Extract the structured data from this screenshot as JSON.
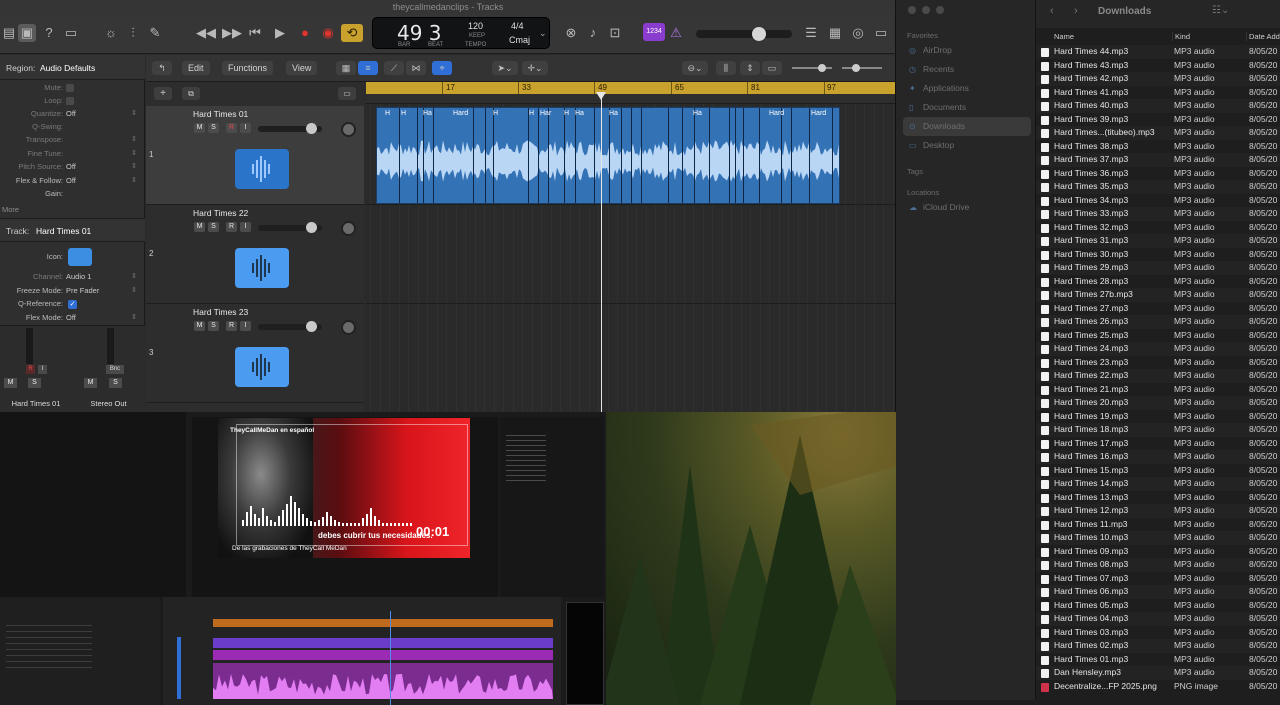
{
  "logic": {
    "window_title": "theycallmedanclips - Tracks",
    "lcd": {
      "bar_beat": "49 3",
      "bar_label": "BAR",
      "beat_label": "BEAT",
      "tempo": "120",
      "keep": "KEEP",
      "tempo_label": "TEMPO",
      "signature": "4/4",
      "key": "Cmaj"
    },
    "badge": "1234",
    "menu": {
      "edit": "Edit",
      "functions": "Functions",
      "view": "View"
    },
    "inspector": {
      "region_label": "Region:",
      "region_value": "Audio Defaults",
      "rows": [
        {
          "label": "Mute:",
          "value": ""
        },
        {
          "label": "Loop:",
          "value": ""
        },
        {
          "label": "Quantize:",
          "value": "Off"
        },
        {
          "label": "Q-Swing:",
          "value": ""
        },
        {
          "label": "Transpose:",
          "value": ""
        },
        {
          "label": "Fine Tune:",
          "value": ""
        },
        {
          "label": "Pitch Source:",
          "value": "Off"
        },
        {
          "label": "Flex & Follow:",
          "value": "Off"
        },
        {
          "label": "Gain:",
          "value": ""
        }
      ],
      "more": "More",
      "track_label": "Track:",
      "track_value": "Hard Times 01",
      "track_rows": [
        {
          "label": "Icon:",
          "value": ""
        },
        {
          "label": "Channel:",
          "value": "Audio 1"
        },
        {
          "label": "Freeze Mode:",
          "value": "Pre Fader"
        },
        {
          "label": "Q-Reference:",
          "value": ""
        },
        {
          "label": "Flex Mode:",
          "value": "Off"
        }
      ]
    },
    "mixer": {
      "strip1": "Hard Times 01",
      "strip2": "Stereo Out",
      "m": "M",
      "s": "S",
      "bnc": "Bnc",
      "i": "I"
    },
    "tracks": [
      {
        "num": "1",
        "name": "Hard Times 01"
      },
      {
        "num": "2",
        "name": "Hard Times 22"
      },
      {
        "num": "3",
        "name": "Hard Times 23"
      }
    ],
    "track_buttons": {
      "m": "M",
      "s": "S",
      "r": "R",
      "i": "I"
    },
    "ruler": [
      "17",
      "33",
      "49",
      "65",
      "81",
      "97"
    ],
    "region_labels": [
      "H",
      "H",
      "Ha",
      "Hard",
      "H",
      "H",
      "Har",
      "H",
      "Ha",
      "Ha",
      "Ha",
      "Hard",
      "Hard"
    ]
  },
  "finder": {
    "title": "Downloads",
    "favorites_label": "Favorites",
    "favorites": [
      "AirDrop",
      "Recents",
      "Applications",
      "Documents",
      "Downloads",
      "Desktop"
    ],
    "tags_label": "Tags",
    "locations_label": "Locations",
    "locations": [
      "iCloud Drive"
    ],
    "columns": {
      "name": "Name",
      "kind": "Kind",
      "date": "Date Added"
    },
    "files": [
      {
        "name": "Hard Times 44.mp3",
        "kind": "MP3 audio",
        "date": "8/05/20"
      },
      {
        "name": "Hard Times 43.mp3",
        "kind": "MP3 audio",
        "date": "8/05/20"
      },
      {
        "name": "Hard Times 42.mp3",
        "kind": "MP3 audio",
        "date": "8/05/20"
      },
      {
        "name": "Hard Times 41.mp3",
        "kind": "MP3 audio",
        "date": "8/05/20"
      },
      {
        "name": "Hard Times 40.mp3",
        "kind": "MP3 audio",
        "date": "8/05/20"
      },
      {
        "name": "Hard Times 39.mp3",
        "kind": "MP3 audio",
        "date": "8/05/20"
      },
      {
        "name": "Hard Times...(titubeo).mp3",
        "kind": "MP3 audio",
        "date": "8/05/20"
      },
      {
        "name": "Hard Times 38.mp3",
        "kind": "MP3 audio",
        "date": "8/05/20"
      },
      {
        "name": "Hard Times 37.mp3",
        "kind": "MP3 audio",
        "date": "8/05/20"
      },
      {
        "name": "Hard Times 36.mp3",
        "kind": "MP3 audio",
        "date": "8/05/20"
      },
      {
        "name": "Hard Times 35.mp3",
        "kind": "MP3 audio",
        "date": "8/05/20"
      },
      {
        "name": "Hard Times 34.mp3",
        "kind": "MP3 audio",
        "date": "8/05/20"
      },
      {
        "name": "Hard Times 33.mp3",
        "kind": "MP3 audio",
        "date": "8/05/20"
      },
      {
        "name": "Hard Times 32.mp3",
        "kind": "MP3 audio",
        "date": "8/05/20"
      },
      {
        "name": "Hard Times 31.mp3",
        "kind": "MP3 audio",
        "date": "8/05/20"
      },
      {
        "name": "Hard Times 30.mp3",
        "kind": "MP3 audio",
        "date": "8/05/20"
      },
      {
        "name": "Hard Times 29.mp3",
        "kind": "MP3 audio",
        "date": "8/05/20"
      },
      {
        "name": "Hard Times 28.mp3",
        "kind": "MP3 audio",
        "date": "8/05/20"
      },
      {
        "name": "Hard Times 27b.mp3",
        "kind": "MP3 audio",
        "date": "8/05/20"
      },
      {
        "name": "Hard Times 27.mp3",
        "kind": "MP3 audio",
        "date": "8/05/20"
      },
      {
        "name": "Hard Times 26.mp3",
        "kind": "MP3 audio",
        "date": "8/05/20"
      },
      {
        "name": "Hard Times 25.mp3",
        "kind": "MP3 audio",
        "date": "8/05/20"
      },
      {
        "name": "Hard Times 24.mp3",
        "kind": "MP3 audio",
        "date": "8/05/20"
      },
      {
        "name": "Hard Times 23.mp3",
        "kind": "MP3 audio",
        "date": "8/05/20"
      },
      {
        "name": "Hard Times 22.mp3",
        "kind": "MP3 audio",
        "date": "8/05/20"
      },
      {
        "name": "Hard Times 21.mp3",
        "kind": "MP3 audio",
        "date": "8/05/20"
      },
      {
        "name": "Hard Times 20.mp3",
        "kind": "MP3 audio",
        "date": "8/05/20"
      },
      {
        "name": "Hard Times 19.mp3",
        "kind": "MP3 audio",
        "date": "8/05/20"
      },
      {
        "name": "Hard Times 18.mp3",
        "kind": "MP3 audio",
        "date": "8/05/20"
      },
      {
        "name": "Hard Times 17.mp3",
        "kind": "MP3 audio",
        "date": "8/05/20"
      },
      {
        "name": "Hard Times 16.mp3",
        "kind": "MP3 audio",
        "date": "8/05/20"
      },
      {
        "name": "Hard Times 15.mp3",
        "kind": "MP3 audio",
        "date": "8/05/20"
      },
      {
        "name": "Hard Times 14.mp3",
        "kind": "MP3 audio",
        "date": "8/05/20"
      },
      {
        "name": "Hard Times 13.mp3",
        "kind": "MP3 audio",
        "date": "8/05/20"
      },
      {
        "name": "Hard Times 12.mp3",
        "kind": "MP3 audio",
        "date": "8/05/20"
      },
      {
        "name": "Hard Times 11.mp3",
        "kind": "MP3 audio",
        "date": "8/05/20"
      },
      {
        "name": "Hard Times 10.mp3",
        "kind": "MP3 audio",
        "date": "8/05/20"
      },
      {
        "name": "Hard Times 09.mp3",
        "kind": "MP3 audio",
        "date": "8/05/20"
      },
      {
        "name": "Hard Times 08.mp3",
        "kind": "MP3 audio",
        "date": "8/05/20"
      },
      {
        "name": "Hard Times 07.mp3",
        "kind": "MP3 audio",
        "date": "8/05/20"
      },
      {
        "name": "Hard Times 06.mp3",
        "kind": "MP3 audio",
        "date": "8/05/20"
      },
      {
        "name": "Hard Times 05.mp3",
        "kind": "MP3 audio",
        "date": "8/05/20"
      },
      {
        "name": "Hard Times 04.mp3",
        "kind": "MP3 audio",
        "date": "8/05/20"
      },
      {
        "name": "Hard Times 03.mp3",
        "kind": "MP3 audio",
        "date": "8/05/20"
      },
      {
        "name": "Hard Times 02.mp3",
        "kind": "MP3 audio",
        "date": "8/05/20"
      },
      {
        "name": "Hard Times 01.mp3",
        "kind": "MP3 audio",
        "date": "8/05/20"
      },
      {
        "name": "Dan Hensley.mp3",
        "kind": "MP3 audio",
        "date": "8/05/20"
      },
      {
        "name": "Decentralize...FP 2025.png",
        "kind": "PNG image",
        "date": "8/05/20"
      }
    ]
  },
  "premiere": {
    "video_title": "TheyCallMeDan en español",
    "subtitle": "debes cubrir tus necesidades.",
    "timecode": "00:01",
    "credit": "De las grabaciones de TheyCall MeDan"
  },
  "colors": {
    "accent_yellow": "#c9a12d",
    "region_blue": "#3472b6",
    "track_icon_blue": "#3c8ee3",
    "record_red": "#e0342f",
    "video_red": "#d8151a"
  }
}
